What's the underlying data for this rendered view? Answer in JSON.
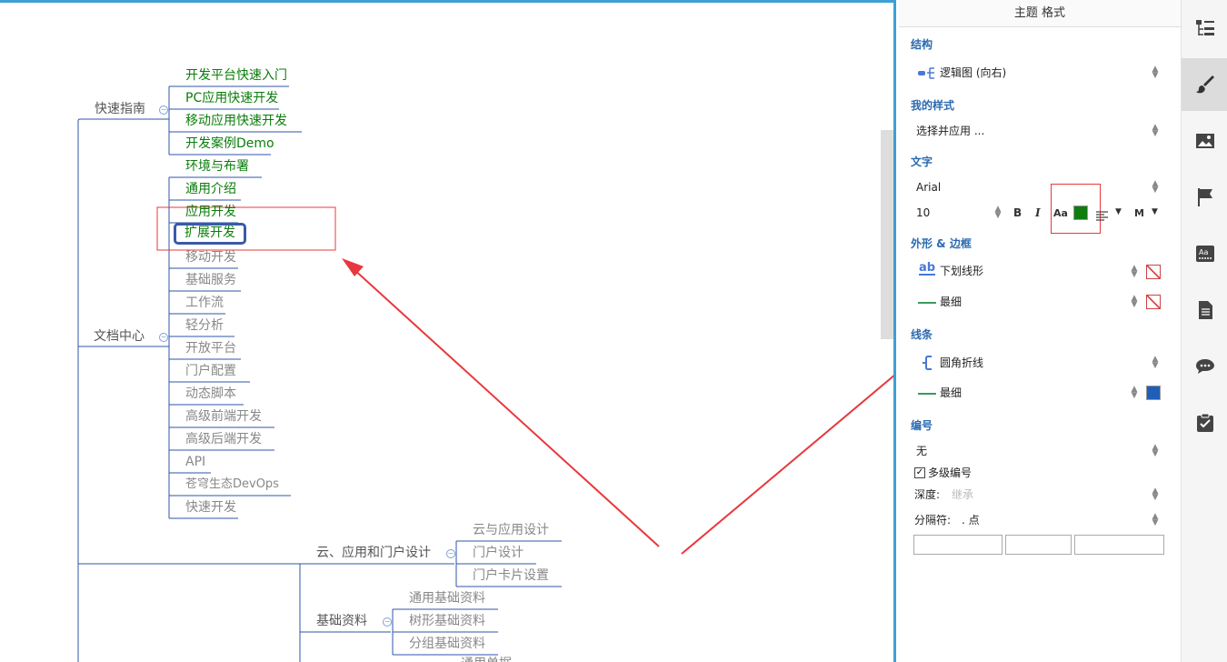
{
  "mindmap": {
    "branch1": {
      "label": "快速指南",
      "children": [
        "开发平台快速入门",
        "PC应用快速开发",
        "移动应用快速开发",
        "开发案例Demo"
      ]
    },
    "branch2": {
      "label": "文档中心",
      "children": [
        "环境与布署",
        "通用介绍",
        "应用开发",
        "扩展开发",
        "移动开发",
        "基础服务",
        "工作流",
        "轻分析",
        "开放平台",
        "门户配置",
        "动态脚本",
        "高级前端开发",
        "高级后端开发",
        "API",
        "苍穹生态DevOps",
        "快速开发"
      ]
    },
    "branch3": {
      "label": "云、应用和门户设计",
      "children": [
        "云与应用设计",
        "门户设计",
        "门户卡片设置"
      ]
    },
    "branch4": {
      "label": "基础资料",
      "children": [
        "通用基础资料",
        "树形基础资料",
        "分组基础资料"
      ]
    },
    "partial": "通用单据"
  },
  "panel": {
    "title": "主题 格式",
    "structure": {
      "heading": "结构",
      "value": "逻辑图 (向右)"
    },
    "my_style": {
      "heading": "我的样式",
      "value": "选择并应用 ..."
    },
    "text": {
      "heading": "文字",
      "font": "Arial",
      "size": "10",
      "bold": "B",
      "italic": "I",
      "case": "Aa",
      "color": "#107c10",
      "align_more": "M"
    },
    "shape": {
      "heading": "外形 & 边框",
      "shape_icon": "ab",
      "shape_value": "下划线形",
      "border_value": "最细"
    },
    "lines": {
      "heading": "线条",
      "style_value": "圆角折线",
      "width_value": "最细",
      "color": "#1f5fb8"
    },
    "numbering": {
      "heading": "编号",
      "value": "无",
      "multi_label": "多级编号",
      "multi_checked": true,
      "depth_label": "深度:",
      "depth_value": "继承",
      "sep_label": "分隔符:",
      "sep_value": ". 点"
    }
  },
  "colors": {
    "accent": "#3d9fd3",
    "node_text": "#107c10",
    "annotation": "#e8383d"
  }
}
